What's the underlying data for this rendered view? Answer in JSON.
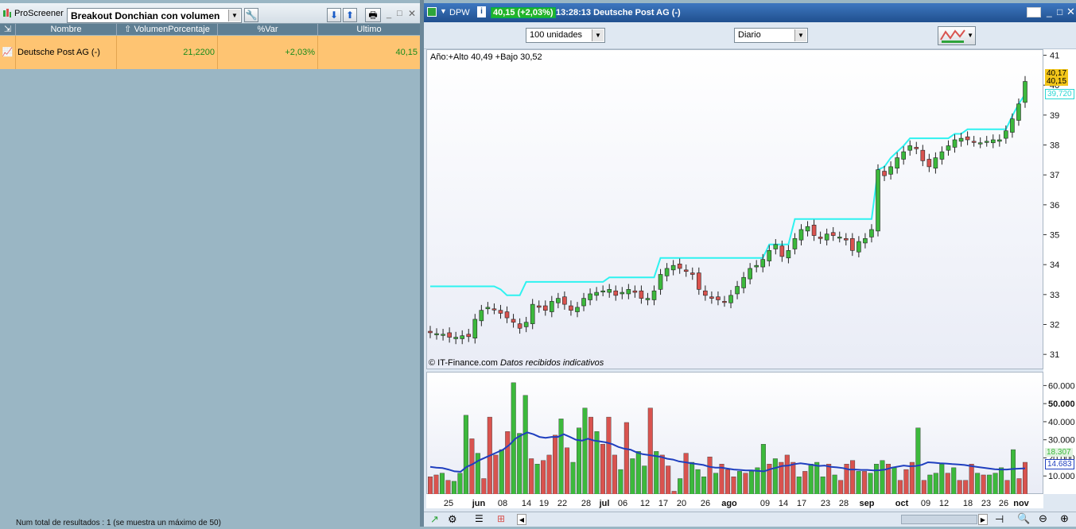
{
  "screener": {
    "app_name": "ProScreener",
    "selected": "Breakout Donchian con volumen",
    "columns": [
      "Nombre",
      "VolumenPorcentaje",
      "%Var",
      "Ultimo"
    ],
    "rows": [
      {
        "name": "Deutsche Post AG (-)",
        "volumen": "21,2200",
        "var": "+2,03%",
        "ultimo": "40,15"
      }
    ],
    "status": "Num total de resultados : 1 (se muestra un máximo de 50)"
  },
  "chart_window": {
    "ticker": "DPW",
    "price_badge": "40,15 (+2,03%)",
    "time_title": "13:28:13 Deutsche Post AG (-)",
    "units_select": "100 unidades",
    "period_select": "Diario",
    "info_text": "Año:+Alto 40,49 +Bajo 30,52",
    "source_text": "© IT-Finance.com",
    "source_note": "Datos recibidos indicativos",
    "price_label_1": "40,17",
    "price_label_2": "40,15",
    "channel_label": "39,720",
    "vol_label_1": "18.307",
    "vol_label_2": "14.683",
    "colors": {
      "up": "#3cb93c",
      "down": "#d9534f",
      "channel": "#2ef2f0",
      "vol_ma": "#1f3fbf",
      "badge": "#22b42a"
    }
  },
  "chart_data": [
    {
      "type": "candlestick",
      "title": "",
      "ylim": [
        30.5,
        41.2
      ],
      "yticks": [
        "31",
        "32",
        "33",
        "34",
        "35",
        "36",
        "37",
        "38",
        "39",
        "40",
        "41"
      ],
      "xticks": [
        "25",
        "jun",
        "08",
        "14",
        "19",
        "22",
        "28",
        "jul",
        "06",
        "12",
        "17",
        "20",
        "26",
        "ago",
        "09",
        "14",
        "17",
        "23",
        "28",
        "sep",
        "oct",
        "09",
        "12",
        "18",
        "23",
        "26",
        "nov"
      ],
      "close": [
        31.75,
        31.72,
        31.7,
        31.6,
        31.6,
        31.65,
        31.62,
        32.2,
        32.5,
        32.6,
        32.55,
        32.4,
        32.25,
        32.1,
        31.9,
        32.1,
        32.7,
        32.6,
        32.5,
        32.8,
        32.9,
        32.7,
        32.5,
        32.6,
        32.9,
        33.05,
        33.1,
        33.15,
        33.2,
        33.0,
        33.1,
        33.2,
        33.1,
        32.9,
        32.9,
        33.15,
        33.7,
        33.9,
        34.0,
        33.9,
        33.8,
        33.7,
        33.2,
        33.0,
        32.9,
        32.85,
        32.8,
        33.0,
        33.3,
        33.6,
        33.9,
        34.0,
        34.2,
        34.5,
        34.7,
        34.3,
        34.5,
        34.9,
        35.2,
        35.3,
        35.0,
        34.9,
        35.05,
        35.0,
        34.95,
        34.85,
        34.5,
        34.8,
        34.9,
        35.2,
        37.2,
        37.0,
        37.3,
        37.6,
        37.8,
        38.0,
        37.9,
        37.5,
        37.3,
        37.6,
        37.8,
        38.0,
        38.2,
        38.25,
        38.2,
        38.15,
        38.1,
        38.15,
        38.2,
        38.2,
        38.5,
        38.9,
        39.4,
        40.15
      ],
      "open_close_bias": "computed",
      "channel": [
        33.3,
        33.3,
        33.3,
        33.3,
        33.3,
        33.3,
        33.3,
        33.3,
        33.3,
        33.3,
        33.3,
        33.2,
        33.0,
        33.0,
        33.0,
        33.45,
        33.45,
        33.45,
        33.45,
        33.45,
        33.45,
        33.45,
        33.45,
        33.45,
        33.45,
        33.45,
        33.45,
        33.45,
        33.6,
        33.6,
        33.6,
        33.6,
        33.6,
        33.6,
        33.6,
        33.6,
        34.25,
        34.25,
        34.25,
        34.25,
        34.25,
        34.25,
        34.25,
        34.25,
        34.25,
        34.25,
        34.25,
        34.25,
        34.25,
        34.25,
        34.25,
        34.25,
        34.25,
        34.7,
        34.7,
        34.7,
        34.7,
        35.55,
        35.55,
        35.55,
        35.55,
        35.55,
        35.55,
        35.55,
        35.55,
        35.55,
        35.55,
        35.55,
        35.55,
        35.55,
        37.2,
        37.3,
        37.6,
        37.8,
        38.0,
        38.25,
        38.25,
        38.25,
        38.25,
        38.25,
        38.25,
        38.25,
        38.4,
        38.4,
        38.55,
        38.55,
        38.55,
        38.55,
        38.55,
        38.55,
        38.55,
        39.0,
        39.4,
        39.72
      ]
    },
    {
      "type": "bar",
      "title": "",
      "ylim": [
        0,
        65000
      ],
      "yticks": [
        "10.000",
        "20.000",
        "30.000",
        "40.000",
        "50.000",
        "60.000"
      ],
      "values": [
        10000,
        11000,
        12000,
        8000,
        7500,
        12000,
        44000,
        31000,
        23000,
        9000,
        43000,
        22000,
        25000,
        35000,
        62000,
        34000,
        55000,
        20000,
        17000,
        19000,
        22000,
        33000,
        42000,
        26000,
        18000,
        37000,
        48000,
        43000,
        35000,
        28000,
        43000,
        22000,
        14000,
        40000,
        20000,
        24000,
        16000,
        48000,
        24000,
        22000,
        16000,
        2000,
        9000,
        23000,
        18000,
        14000,
        10000,
        21000,
        12000,
        17000,
        14000,
        10000,
        13000,
        12000,
        13000,
        15000,
        28000,
        17000,
        20000,
        18000,
        22000,
        18000,
        10000,
        13000,
        17000,
        18000,
        10000,
        17000,
        11000,
        8000,
        17000,
        19000,
        13000,
        13000,
        12000,
        17000,
        19000,
        17000,
        15000,
        8000,
        14000,
        18000,
        37000,
        8000,
        11000,
        12000,
        17000,
        12000,
        15000,
        8000,
        8000,
        17000,
        12000,
        11000,
        11000,
        12000,
        15000,
        8000,
        25000,
        9000,
        18000
      ],
      "ma": [
        15500,
        15000,
        14800,
        14000,
        13000,
        12800,
        15500,
        17000,
        19000,
        20500,
        22000,
        23500,
        25000,
        27500,
        31000,
        33000,
        34500,
        33500,
        32000,
        31500,
        32000,
        32000,
        33500,
        32000,
        30500,
        30000,
        31000,
        30000,
        29500,
        29000,
        28000,
        26500,
        25500,
        25000,
        23500,
        22500,
        22000,
        21500,
        21000,
        20000,
        19500,
        18500,
        18000,
        17500,
        17000,
        16500,
        15500,
        15000,
        15000,
        14500,
        14000,
        13800,
        13500,
        13500,
        13200,
        13000,
        14200,
        15000,
        16000,
        16200,
        17000,
        17500,
        17000,
        16500,
        16000,
        16200,
        15500,
        15200,
        14800,
        14000,
        14000,
        13800,
        13800,
        13500,
        13600,
        14000,
        15000,
        15600,
        16200,
        15800,
        16000,
        16600,
        18000,
        17800,
        17500,
        17300,
        17000,
        16800,
        16500,
        16000,
        15500,
        15000,
        14600,
        14200,
        14000,
        14000,
        14300,
        14500,
        14683
      ]
    }
  ]
}
